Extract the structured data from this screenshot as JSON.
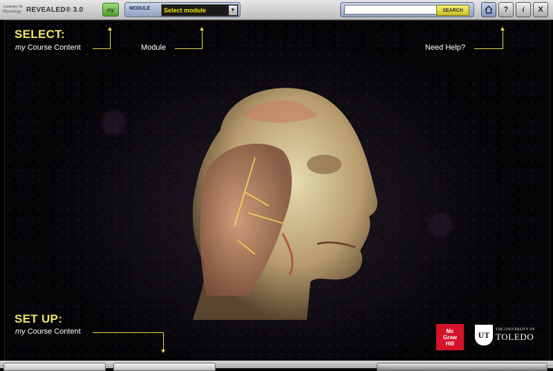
{
  "app": {
    "logo_small": "Anatomy & Physiology",
    "logo_big": "REVEALED® 3.0"
  },
  "toolbar": {
    "my_label": "my",
    "module_label": "MODULE",
    "module_value": "Select module",
    "search_placeholder": "",
    "search_label": "SEARCH",
    "help_label": "?",
    "info_label": "i",
    "close_label": "X"
  },
  "stage": {
    "select_title": "SELECT:",
    "select_my": "my",
    "select_course": " Course Content",
    "module_link": "Module",
    "help_link": "Need Help?",
    "setup_title": "SET UP:",
    "setup_my": "my",
    "setup_course": " Course Content"
  },
  "logos": {
    "mcgraw_line1": "Mc",
    "mcgraw_line2": "Graw",
    "mcgraw_line3": "Hill",
    "ut_mark": "UT",
    "ut_small": "THE UNIVERSITY OF",
    "ut_big": "TOLEDO"
  },
  "colors": {
    "accent_yellow": "#efe66a",
    "mcgraw_red": "#d4122a"
  }
}
